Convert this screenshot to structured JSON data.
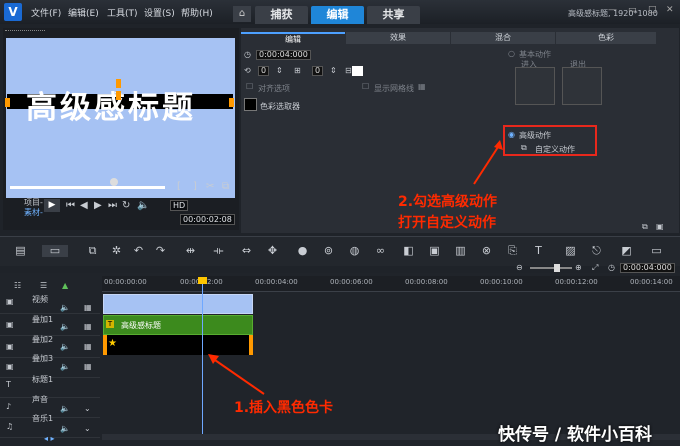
{
  "menu": [
    "文件(F)",
    "编辑(E)",
    "工具(T)",
    "设置(S)",
    "帮助(H)"
  ],
  "main_tabs": [
    "捕获",
    "编辑",
    "共享"
  ],
  "project_info": "高级感标题, 1920*1080",
  "preview": {
    "title_text": "高级感标题",
    "label_project": "项目-",
    "label_clip": "素材-",
    "timecode": "00:00:02:08",
    "hd_label": "HD"
  },
  "options": {
    "tabs": [
      "编辑",
      "效果",
      "混合",
      "色彩"
    ],
    "duration": "0:00:04:000",
    "val1": "0",
    "val2": "0",
    "align_label": "对齐选项",
    "grid_label": "显示网格线",
    "color_picker_label": "色彩选取器",
    "basic_motion": "基本动作",
    "enter_label": "进入",
    "exit_label": "退出",
    "advanced_motion": "高级动作",
    "custom_motion": "自定义动作"
  },
  "annotation_2": [
    "2.勾选高级动作",
    "打开自定义动作"
  ],
  "annotation_1": "1.插入黑色色卡",
  "zoom_timecode": "0:00:04:000",
  "ruler_ticks": [
    "00:00:00:00",
    "00:00:02:00",
    "00:00:04:00",
    "00:00:06:00",
    "00:00:08:00",
    "00:00:10:00",
    "00:00:12:00",
    "00:00:14:00"
  ],
  "tracks": [
    "视频",
    "叠加1",
    "叠加2",
    "叠加3",
    "标题1",
    "声音",
    "音乐1"
  ],
  "clips": {
    "title_clip": "高级感标题"
  },
  "watermark": "快传号 / 软件小百科",
  "colors": {
    "accent": "#1f86d8",
    "annotation_red": "#ff2a00",
    "title_clip_green": "#3c8a1d",
    "preview_bg": "#a6c2f3"
  }
}
